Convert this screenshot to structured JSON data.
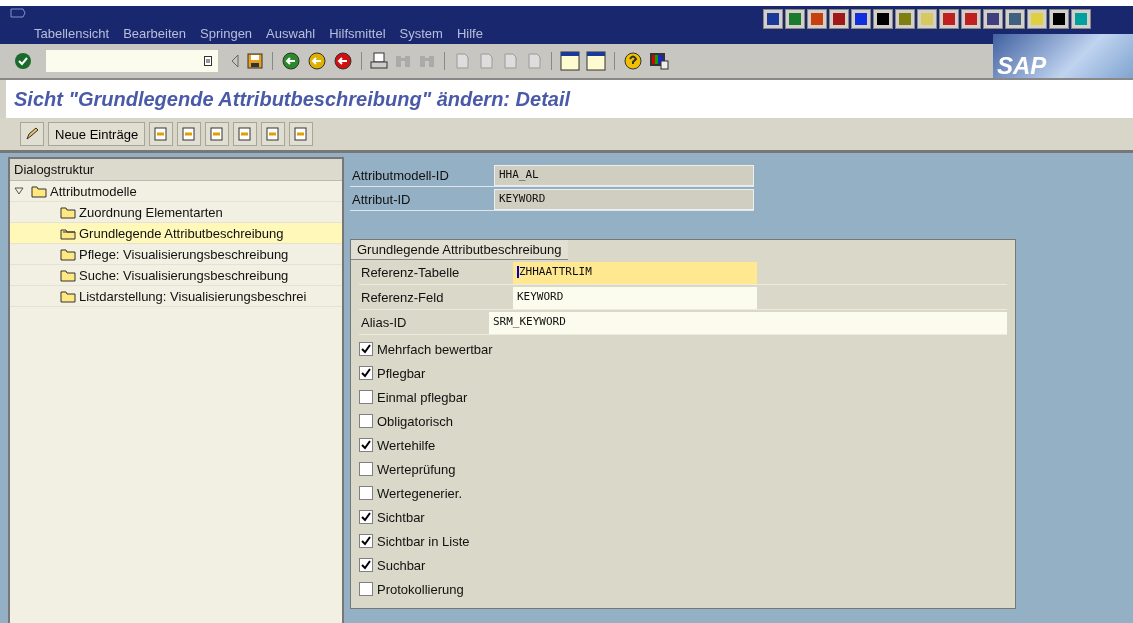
{
  "menu": [
    "Tabellensicht",
    "Bearbeiten",
    "Springen",
    "Auswahl",
    "Hilfsmittel",
    "System",
    "Hilfe"
  ],
  "logo": "SAP",
  "title": "Sicht \"Grundlegende Attributbeschreibung\" ändern: Detail",
  "app_toolbar": {
    "button": "Neue Einträge"
  },
  "tree": {
    "title": "Dialogstruktur",
    "items": [
      {
        "label": "Attributmodelle",
        "expanded": true,
        "selected": false,
        "children": [
          {
            "label": "Zuordnung Elementarten",
            "selected": false
          },
          {
            "label": "Grundlegende Attributbeschreibung",
            "selected": true
          },
          {
            "label": "Pflege: Visualisierungsbeschreibung",
            "selected": false
          },
          {
            "label": "Suche: Visualisierungsbeschreibung",
            "selected": false
          },
          {
            "label": "Listdarstellung: Visualisierungsbeschrei",
            "selected": false
          }
        ]
      }
    ]
  },
  "header_fields": [
    {
      "label": "Attributmodell-ID",
      "value": "HHA_AL"
    },
    {
      "label": "Attribut-ID",
      "value": "KEYWORD"
    }
  ],
  "group": {
    "title": "Grundlegende Attributbeschreibung",
    "fields": [
      {
        "label": "Referenz-Tabelle",
        "value": "ZHHAATTRLIM",
        "focused": true
      },
      {
        "label": "Referenz-Feld",
        "value": "KEYWORD",
        "focused": false
      },
      {
        "label": "Alias-ID",
        "value": "SRM_KEYWORD",
        "focused": false
      }
    ],
    "checkboxes": [
      {
        "label": "Mehrfach bewertbar",
        "checked": true
      },
      {
        "label": "Pflegbar",
        "checked": true
      },
      {
        "label": "Einmal pflegbar",
        "checked": false
      },
      {
        "label": "Obligatorisch",
        "checked": false
      },
      {
        "label": "Wertehilfe",
        "checked": true
      },
      {
        "label": "Werteprüfung",
        "checked": false
      },
      {
        "label": "Wertegenerier.",
        "checked": false
      },
      {
        "label": "Sichtbar",
        "checked": true
      },
      {
        "label": "Sichtbar in Liste",
        "checked": true
      },
      {
        "label": "Suchbar",
        "checked": true
      },
      {
        "label": "Protokollierung",
        "checked": false
      }
    ]
  }
}
